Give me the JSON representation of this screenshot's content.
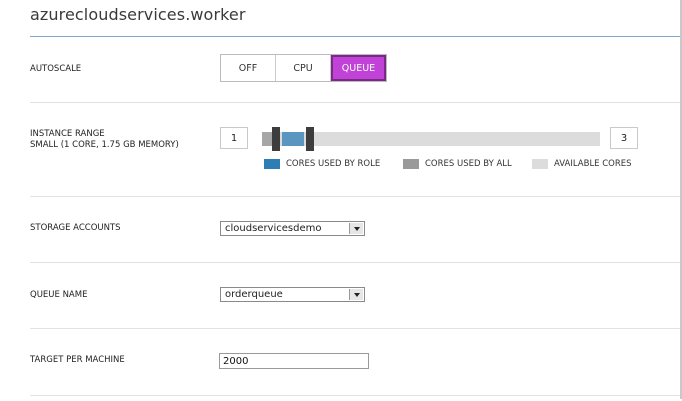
{
  "title": "azurecloudservices.worker",
  "autoscale": {
    "label": "AUTOSCALE",
    "options": [
      "OFF",
      "CPU",
      "QUEUE"
    ],
    "selected": "QUEUE"
  },
  "instance_range": {
    "label_line1": "INSTANCE RANGE",
    "label_line2": "SMALL (1 CORE, 1.75 GB MEMORY)",
    "min": "1",
    "max": "3",
    "legend": [
      {
        "label": "CORES USED BY ROLE",
        "color": "#2e7db5"
      },
      {
        "label": "CORES USED BY ALL",
        "color": "#9a9a9a"
      },
      {
        "label": "AVAILABLE CORES",
        "color": "#dcdcdc"
      }
    ]
  },
  "storage_accounts": {
    "label": "STORAGE ACCOUNTS",
    "selected": "cloudservicesdemo"
  },
  "queue_name": {
    "label": "QUEUE NAME",
    "selected": "orderqueue"
  },
  "target_per_machine": {
    "label": "TARGET PER MACHINE",
    "value": "2000"
  },
  "colors": {
    "accent": "#c142d6",
    "title_rule": "#7fa7cc"
  }
}
